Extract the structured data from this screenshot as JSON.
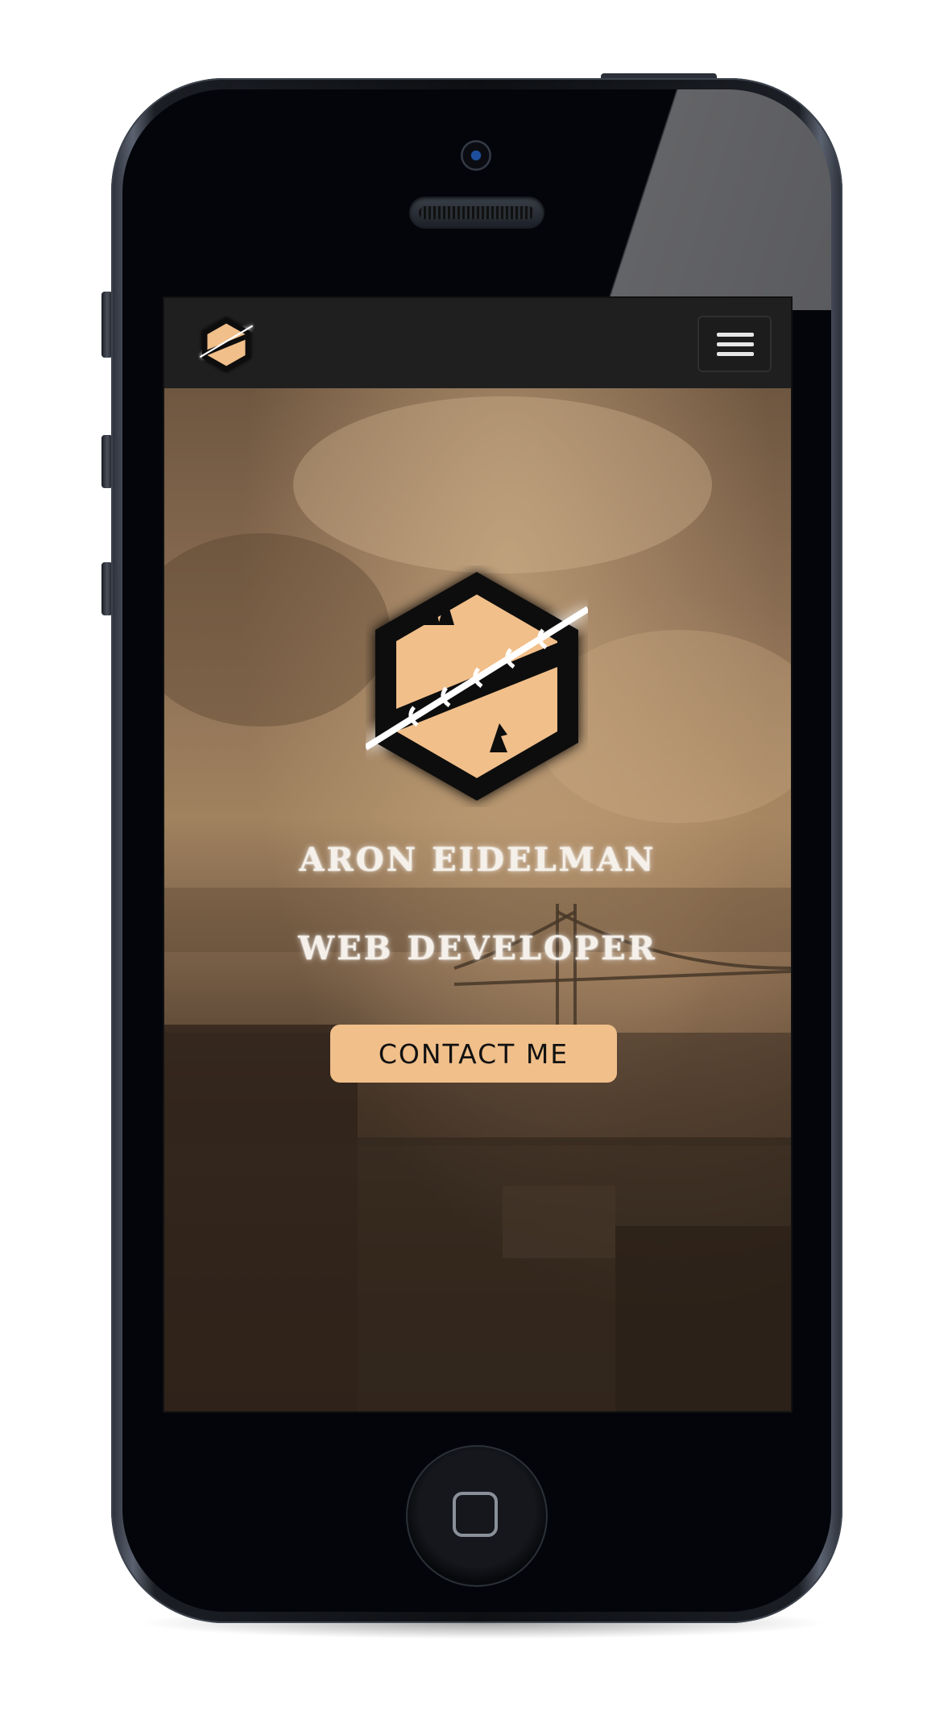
{
  "page": {
    "name": "Aron Eidelman portfolio on iPhone mockup"
  },
  "header": {
    "logo_icon": "hex-spear-logo-icon",
    "menu_icon": "hamburger-menu-icon"
  },
  "hero": {
    "name": "ARON EIDELMAN",
    "title": "WEB DEVELOPER",
    "contact_label": "CONTACT ME",
    "logo_icon": "hex-spear-logo-icon"
  },
  "colors": {
    "accent": "#f1bf8a",
    "navbar": "#1f1f1f",
    "logo_dark": "#111111",
    "text": "#f5f1ea"
  }
}
